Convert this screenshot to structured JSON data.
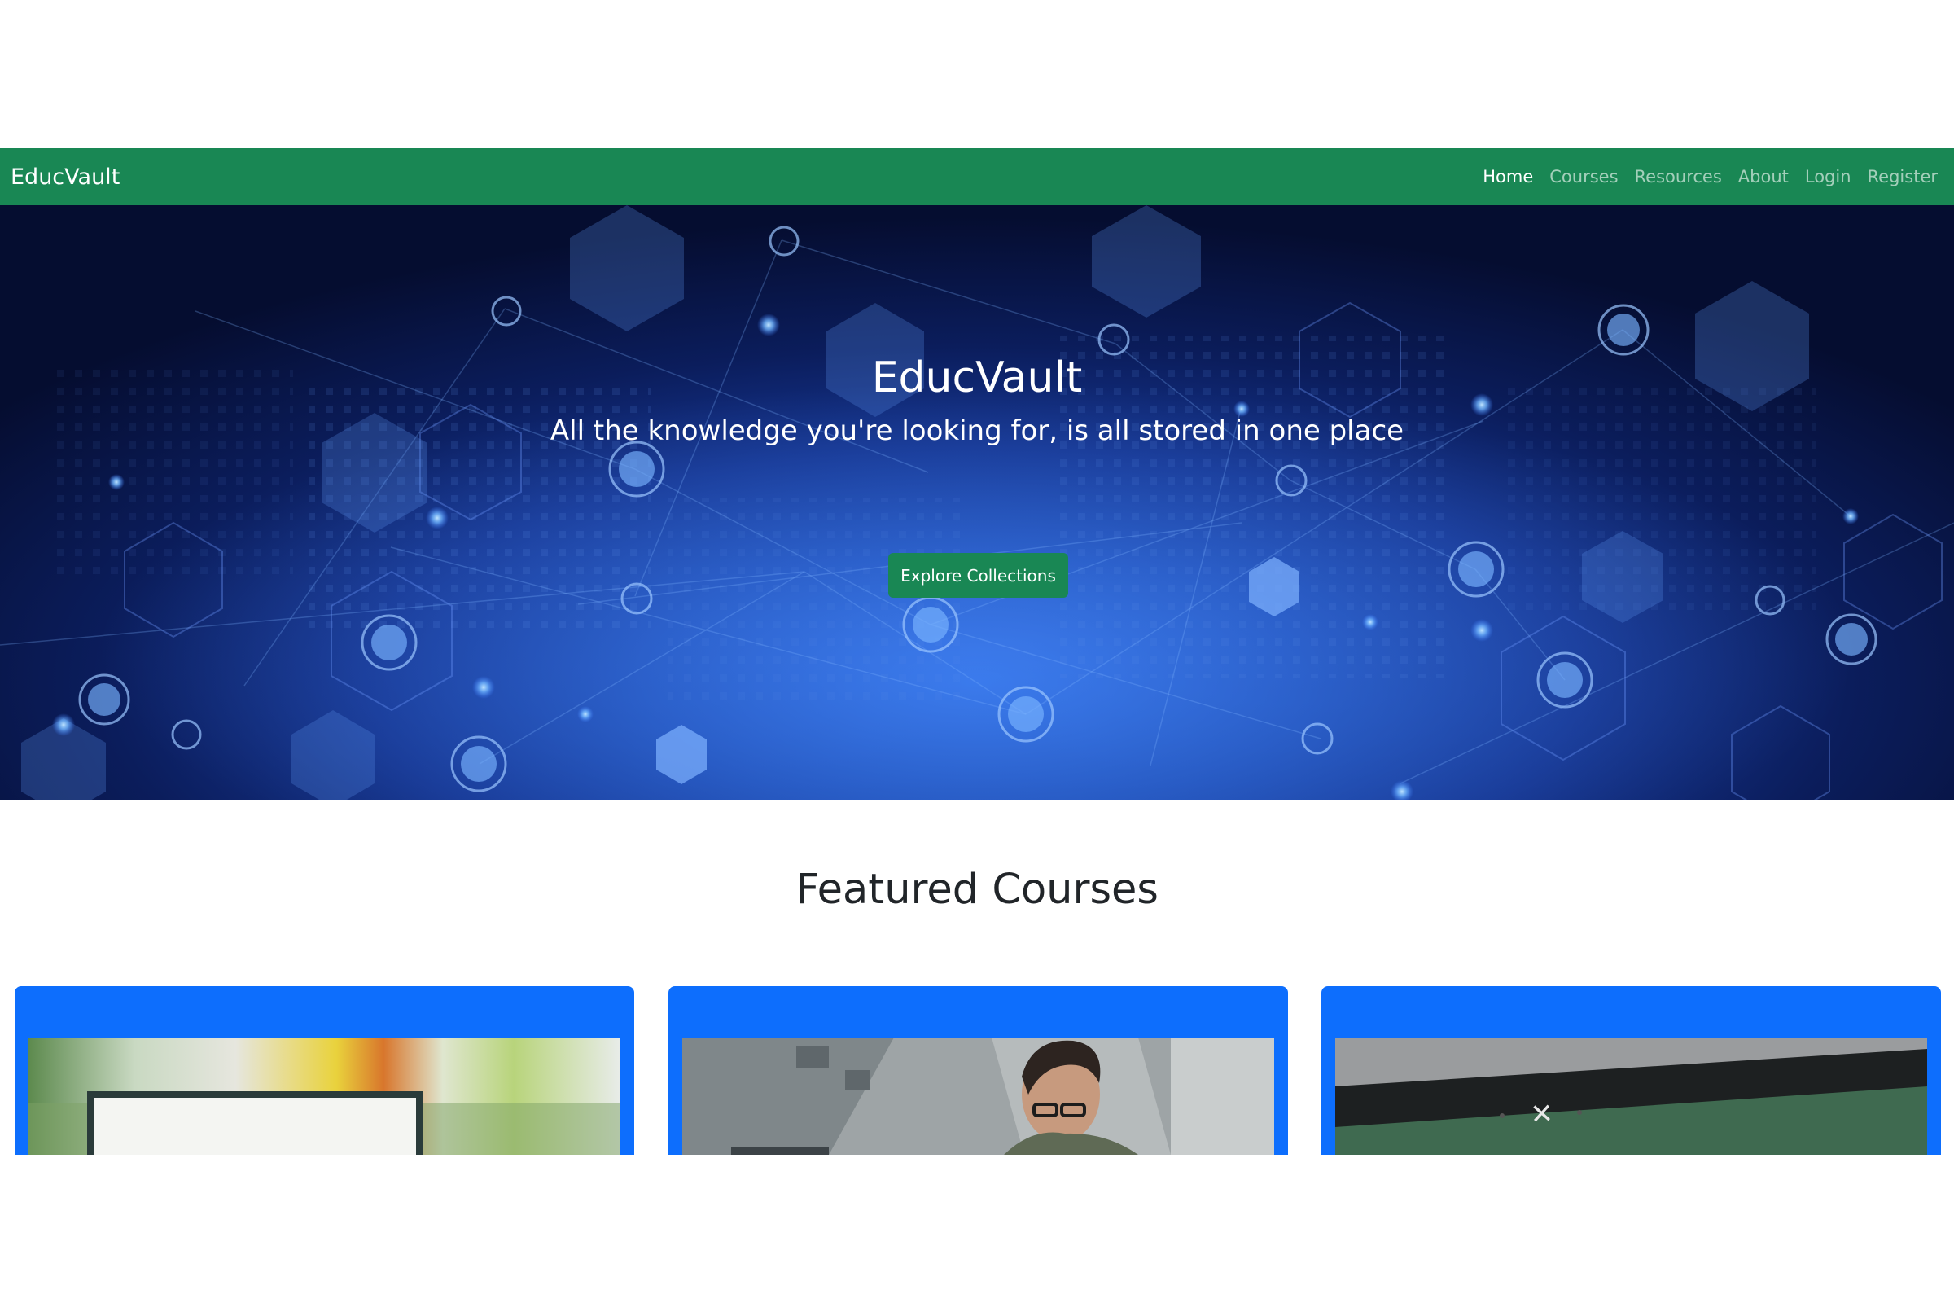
{
  "navbar": {
    "brand": "EducVault",
    "links": [
      {
        "label": "Home",
        "active": true
      },
      {
        "label": "Courses",
        "active": false
      },
      {
        "label": "Resources",
        "active": false
      },
      {
        "label": "About",
        "active": false
      },
      {
        "label": "Login",
        "active": false
      },
      {
        "label": "Register",
        "active": false
      }
    ]
  },
  "hero": {
    "title": "EducVault",
    "subtitle": "All the knowledge you're looking for, is all stored in one place",
    "button_label": "Explore Collections"
  },
  "featured": {
    "title": "Featured Courses",
    "cards": [
      {
        "image": "laptop-blank-screen-photo"
      },
      {
        "image": "man-with-glasses-photo"
      },
      {
        "image": "laptop-excel-screen-photo"
      }
    ]
  },
  "colors": {
    "navbar_bg": "#198754",
    "button_bg": "#198754",
    "card_bg": "#0d6efd",
    "hero_blue": "#1f4fb6",
    "heading_text": "#212529"
  }
}
